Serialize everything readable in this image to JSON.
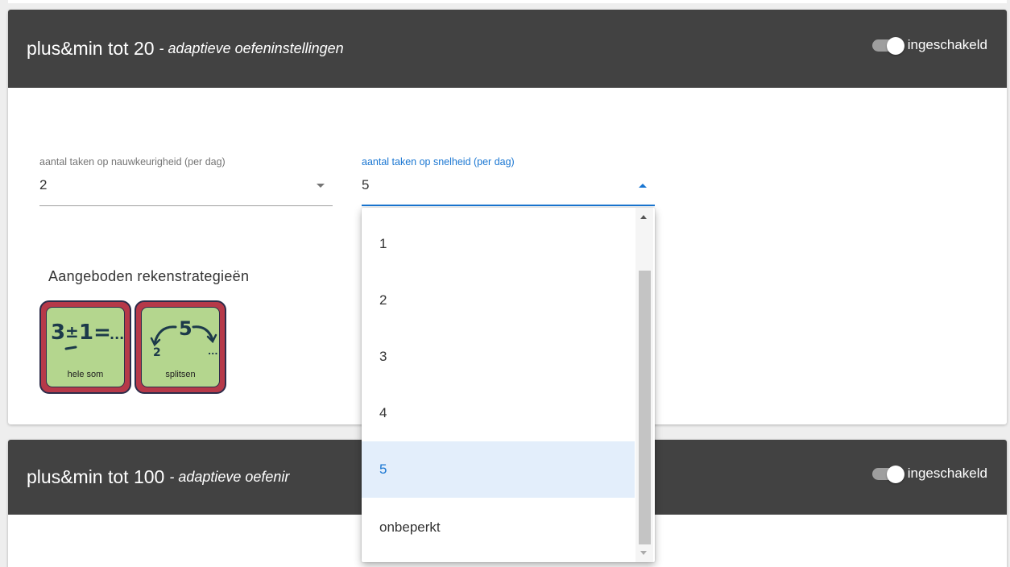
{
  "cards": [
    {
      "title": "plus&min tot 20",
      "subtitle": "- adaptieve oefeninstellingen",
      "toggle_label": "ingeschakeld"
    },
    {
      "title": "plus&min tot 100",
      "subtitle": "- adaptieve oefenir",
      "toggle_label": "ingeschakeld"
    }
  ],
  "fields": {
    "accuracy": {
      "label": "aantal taken op nauwkeurigheid (per dag)",
      "value": "2"
    },
    "speed": {
      "label": "aantal taken op snelheid (per dag)",
      "value": "5"
    }
  },
  "strategies": {
    "title": "Aangeboden rekenstrategieën",
    "tiles": [
      {
        "label": "hele som",
        "icon": "hele-som-icon"
      },
      {
        "label": "splitsen",
        "icon": "splitsen-icon"
      }
    ]
  },
  "dropdown": {
    "options": [
      "1",
      "2",
      "3",
      "4",
      "5",
      "onbeperkt"
    ],
    "selected": "5"
  },
  "colors": {
    "header_bg": "#424242",
    "accent": "#1976d2",
    "selected_bg": "#e3eefb",
    "tile_red": "#b63949",
    "tile_green": "#b4d68e"
  }
}
